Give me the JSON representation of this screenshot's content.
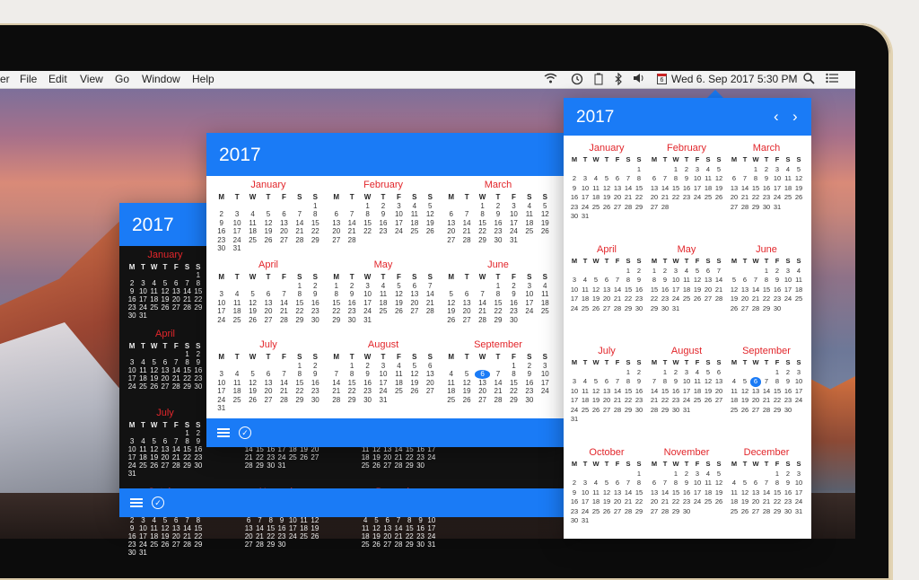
{
  "menubar": {
    "app_name": "er",
    "items": [
      "File",
      "Edit",
      "View",
      "Go",
      "Window",
      "Help"
    ],
    "date_icon_num": "6",
    "clock": "Wed 6. Sep 2017 5:30 PM"
  },
  "windows": {
    "dark": {
      "year": "2017"
    },
    "mid": {
      "year": "2017"
    },
    "right": {
      "year": "2017",
      "prev": "‹",
      "next": "›"
    }
  },
  "footer": {
    "check_glyph": "✓"
  },
  "calendar": {
    "weekday_headers": [
      "M",
      "T",
      "W",
      "T",
      "F",
      "S",
      "S"
    ],
    "months": [
      {
        "name": "January",
        "offset": 6,
        "days": 31
      },
      {
        "name": "February",
        "offset": 2,
        "days": 28
      },
      {
        "name": "March",
        "offset": 2,
        "days": 31
      },
      {
        "name": "April",
        "offset": 5,
        "days": 30
      },
      {
        "name": "May",
        "offset": 0,
        "days": 31
      },
      {
        "name": "June",
        "offset": 3,
        "days": 30
      },
      {
        "name": "July",
        "offset": 5,
        "days": 31
      },
      {
        "name": "August",
        "offset": 1,
        "days": 31
      },
      {
        "name": "September",
        "offset": 4,
        "days": 30
      },
      {
        "name": "October",
        "offset": 6,
        "days": 31
      },
      {
        "name": "November",
        "offset": 2,
        "days": 30
      },
      {
        "name": "December",
        "offset": 4,
        "days": 31
      }
    ],
    "selected_month": "September",
    "selected_day": 6
  }
}
